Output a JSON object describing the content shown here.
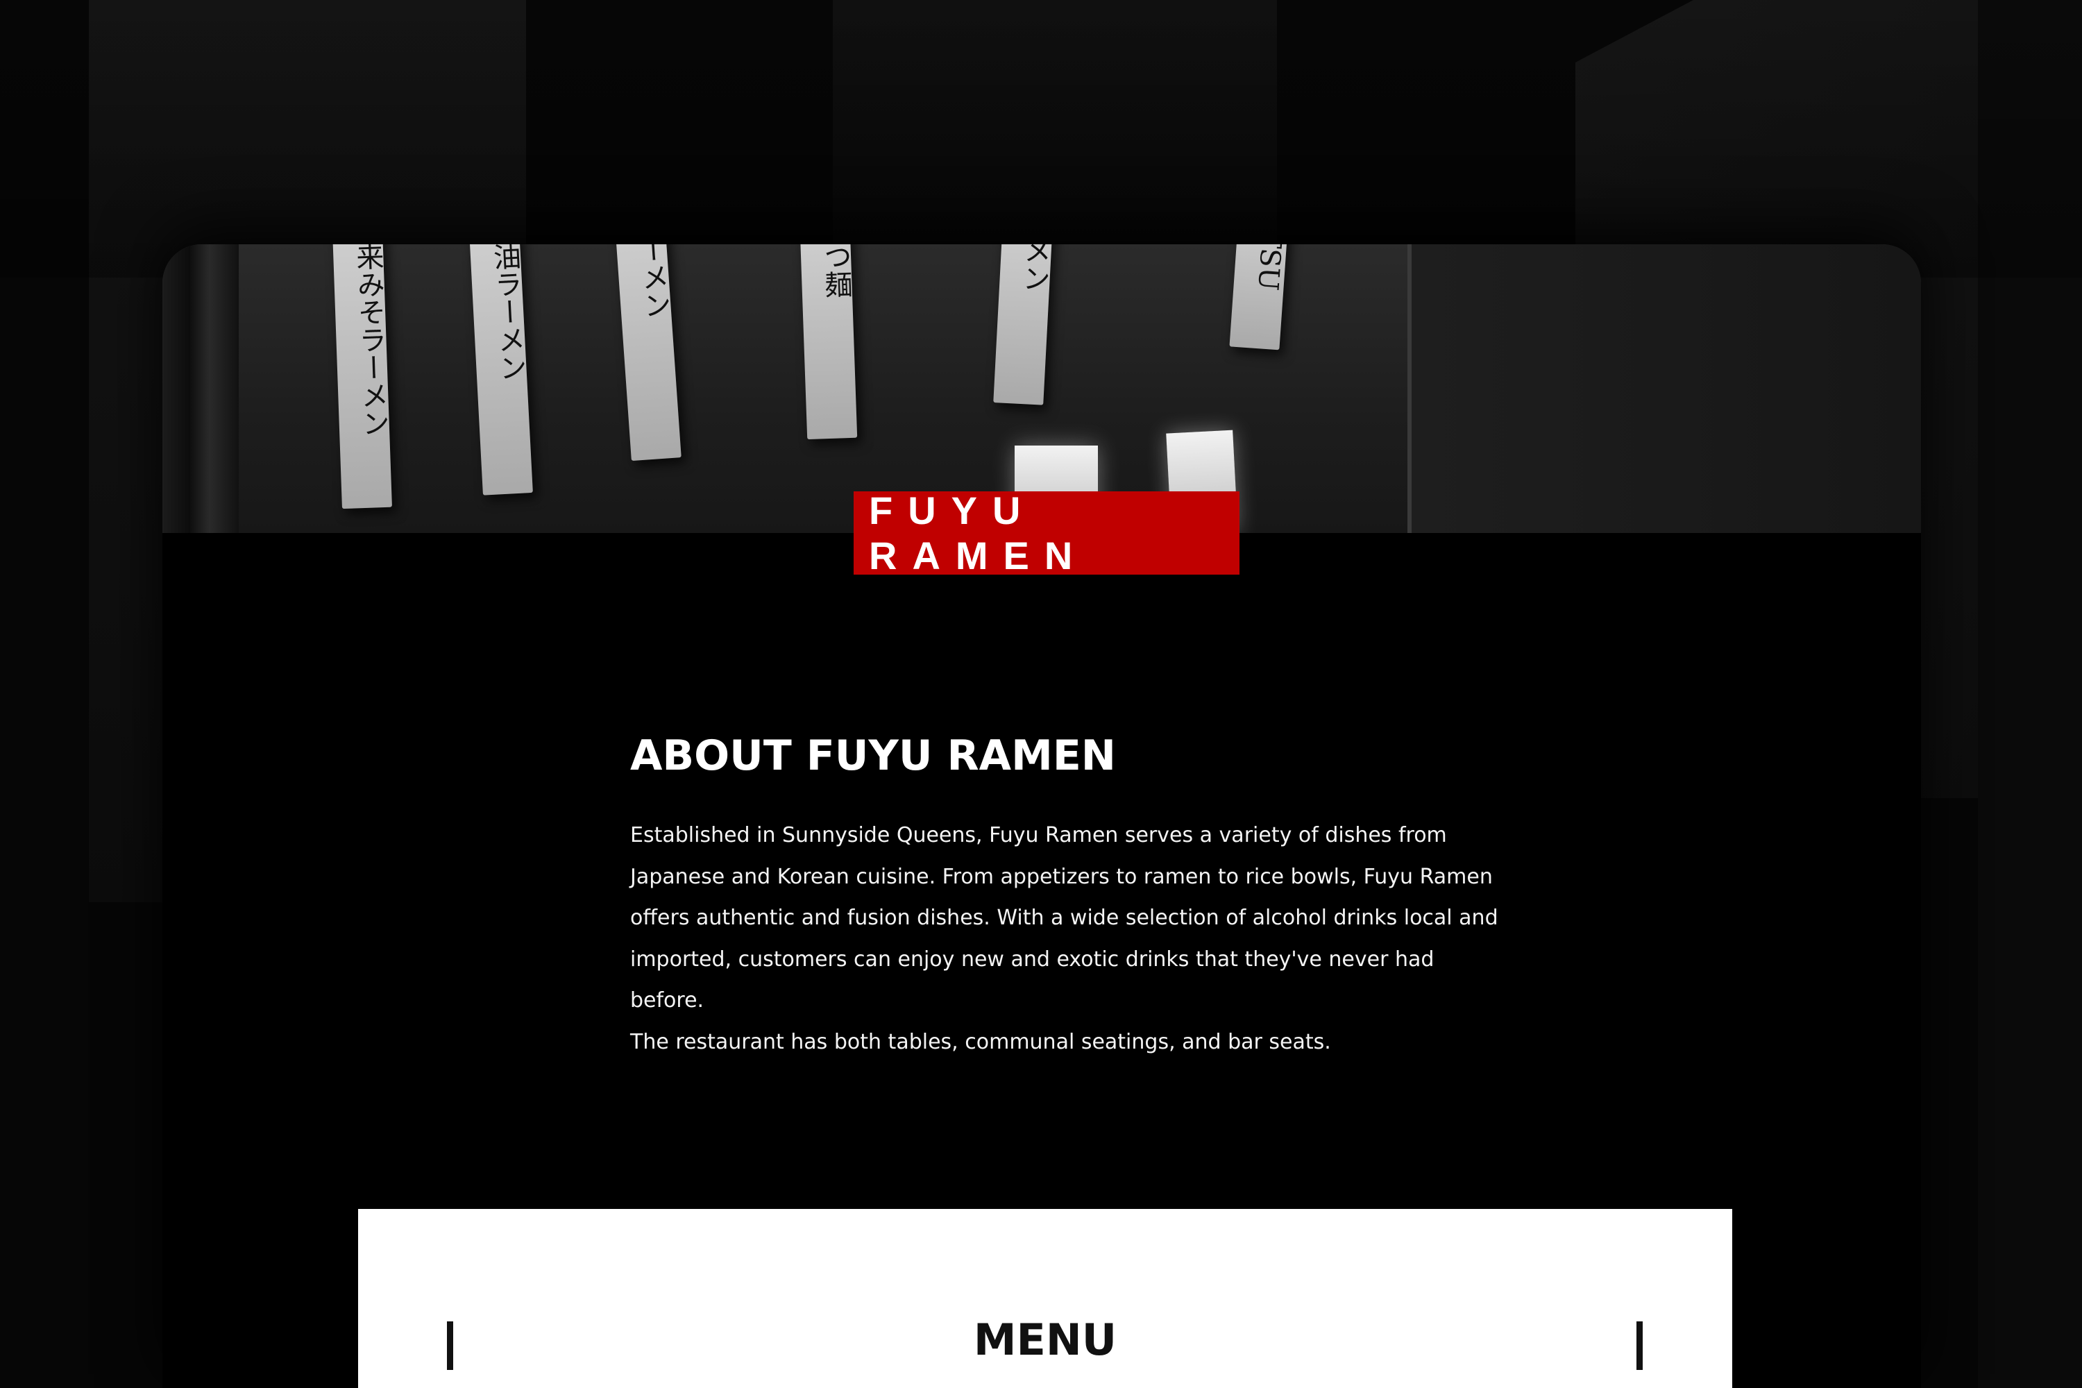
{
  "hero": {
    "badge_text": "FUYU RAMEN",
    "sign_glyphs": [
      "来みそラーメン",
      "油ラーメン",
      "ーメン",
      "つ麺",
      "メン",
      "TSU"
    ]
  },
  "about": {
    "title": "ABOUT FUYU RAMEN",
    "body_lines": [
      "Established in Sunnyside Queens, Fuyu Ramen serves a variety of dishes from",
      "Japanese and Korean cuisine. From appetizers to ramen to rice bowls, Fuyu Ramen",
      "offers authentic and fusion dishes. With a wide selection of alcohol drinks local and",
      "imported, customers can enjoy new and exotic drinks that they've never had before.",
      "The restaurant has both tables, communal seatings, and bar seats."
    ]
  },
  "menu": {
    "title": "MENU"
  },
  "colors": {
    "brand_red": "#c00000",
    "background": "#000000",
    "panel": "#ffffff"
  }
}
